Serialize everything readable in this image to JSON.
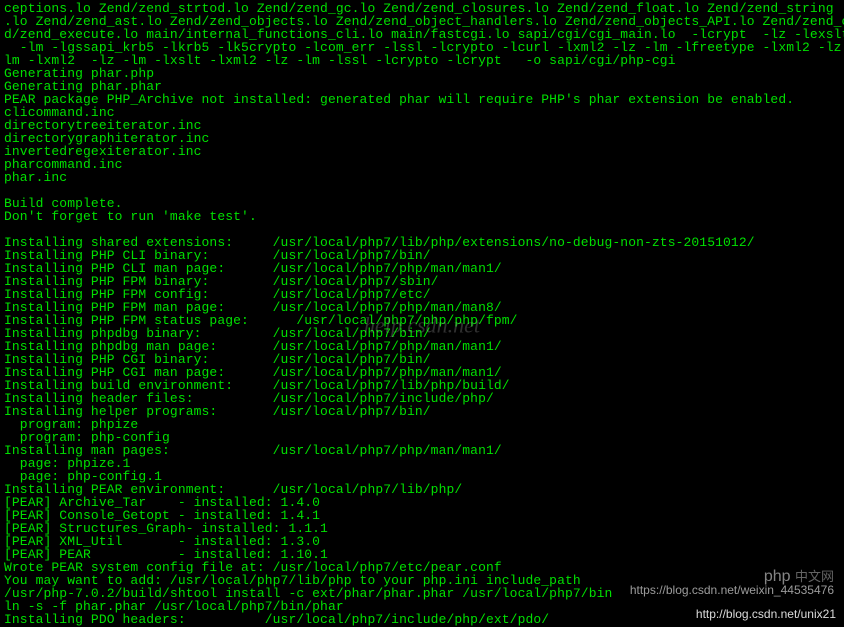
{
  "terminal": [
    "ceptions.lo Zend/zend_strtod.lo Zend/zend_gc.lo Zend/zend_closures.lo Zend/zend_float.lo Zend/zend_string",
    ".lo Zend/zend_ast.lo Zend/zend_objects.lo Zend/zend_object_handlers.lo Zend/zend_objects_API.lo Zend/zend_c",
    "d/zend_execute.lo main/internal_functions_cli.lo main/fastcgi.lo sapi/cgi/cgi_main.lo  -lcrypt  -lz -lexslt",
    "  -lm -lgssapi_krb5 -lkrb5 -lk5crypto -lcom_err -lssl -lcrypto -lcurl -lxml2 -lz -lm -lfreetype -lxml2 -lz",
    "lm -lxml2  -lz -lm -lxslt -lxml2 -lz -lm -lssl -lcrypto -lcrypt   -o sapi/cgi/php-cgi",
    "Generating phar.php",
    "Generating phar.phar",
    "PEAR package PHP_Archive not installed: generated phar will require PHP's phar extension be enabled.",
    "clicommand.inc",
    "directorytreeiterator.inc",
    "directorygraphiterator.inc",
    "invertedregexiterator.inc",
    "pharcommand.inc",
    "phar.inc",
    "",
    "Build complete.",
    "Don't forget to run 'make test'.",
    "",
    "Installing shared extensions:     /usr/local/php7/lib/php/extensions/no-debug-non-zts-20151012/",
    "Installing PHP CLI binary:        /usr/local/php7/bin/",
    "Installing PHP CLI man page:      /usr/local/php7/php/man/man1/",
    "Installing PHP FPM binary:        /usr/local/php7/sbin/",
    "Installing PHP FPM config:        /usr/local/php7/etc/",
    "Installing PHP FPM man page:      /usr/local/php7/php/man/man8/",
    "Installing PHP FPM status page:      /usr/local/php7/php/php/fpm/",
    "Installing phpdbg binary:         /usr/local/php7/bin/",
    "Installing phpdbg man page:       /usr/local/php7/php/man/man1/",
    "Installing PHP CGI binary:        /usr/local/php7/bin/",
    "Installing PHP CGI man page:      /usr/local/php7/php/man/man1/",
    "Installing build environment:     /usr/local/php7/lib/php/build/",
    "Installing header files:          /usr/local/php7/include/php/",
    "Installing helper programs:       /usr/local/php7/bin/",
    "  program: phpize",
    "  program: php-config",
    "Installing man pages:             /usr/local/php7/php/man/man1/",
    "  page: phpize.1",
    "  page: php-config.1",
    "Installing PEAR environment:      /usr/local/php7/lib/php/",
    "[PEAR] Archive_Tar    - installed: 1.4.0",
    "[PEAR] Console_Getopt - installed: 1.4.1",
    "[PEAR] Structures_Graph- installed: 1.1.1",
    "[PEAR] XML_Util       - installed: 1.3.0",
    "[PEAR] PEAR           - installed: 1.10.1",
    "Wrote PEAR system config file at: /usr/local/php7/etc/pear.conf",
    "You may want to add: /usr/local/php7/lib/php to your php.ini include_path",
    "/usr/php-7.0.2/build/shtool install -c ext/phar/phar.phar /usr/local/php7/bin",
    "ln -s -f phar.phar /usr/local/php7/bin/phar",
    "Installing PDO headers:          /usr/local/php7/include/php/ext/pdo/"
  ],
  "watermark_center": "help.csdn.net",
  "watermark_right_line1": "php",
  "watermark_right_line2": "中文网",
  "watermark_csdn": "https://blog.csdn.net/weixin_44535476",
  "watermark_url": "http://blog.csdn.net/unix21"
}
